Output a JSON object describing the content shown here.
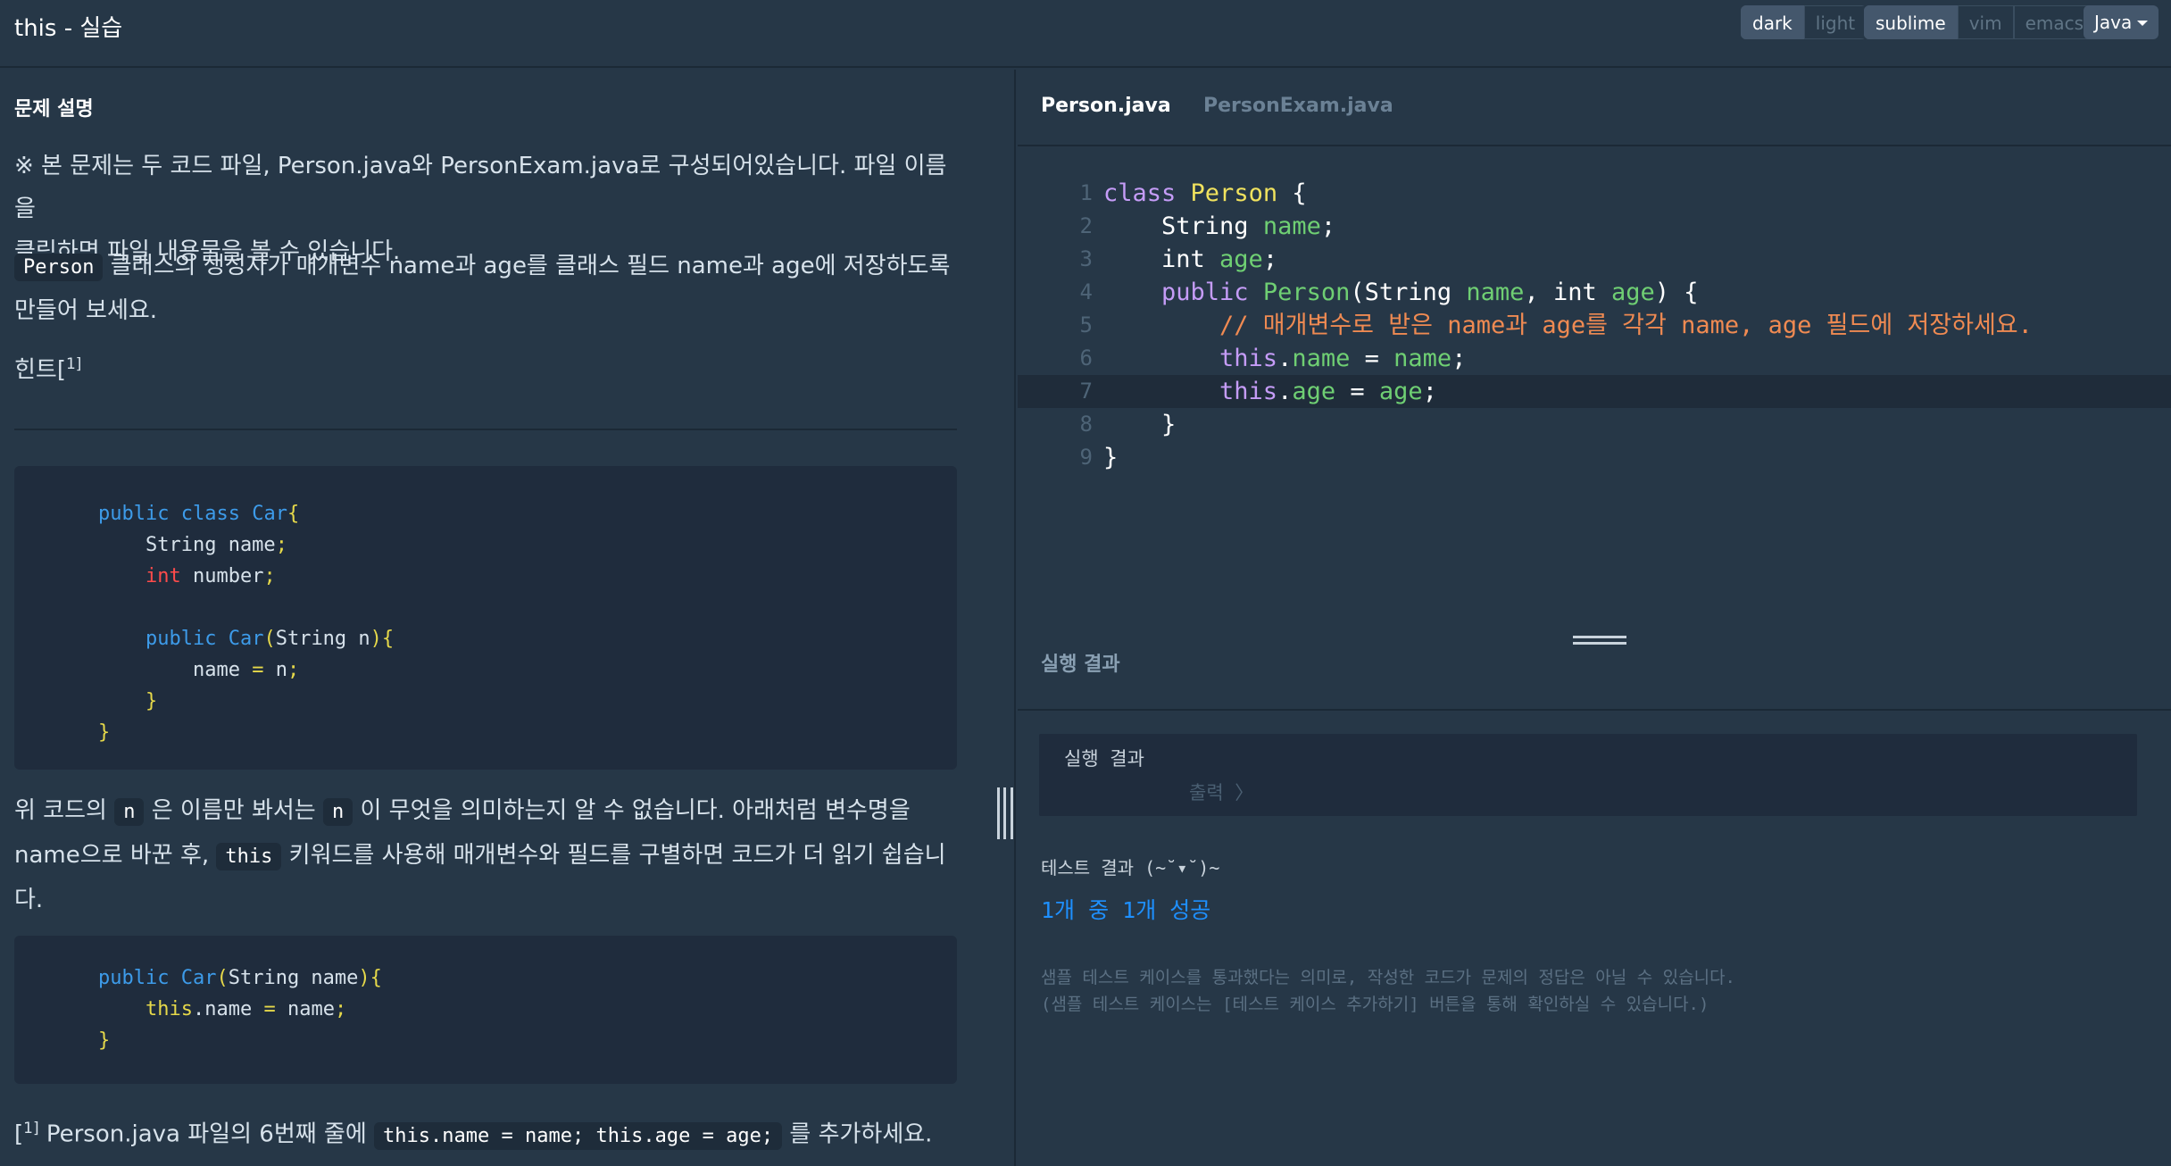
{
  "header": {
    "title": "this - 실습",
    "theme_options": [
      "dark",
      "light"
    ],
    "theme_selected": "dark",
    "keymap_options": [
      "sublime",
      "vim",
      "emacs"
    ],
    "keymap_selected": "sublime",
    "language": "Java"
  },
  "problem": {
    "section_title": "문제 설명",
    "intro_line1": "※ 본 문제는 두 코드 파일, Person.java와 PersonExam.java로 구성되어있습니다. 파일 이름을",
    "intro_line2": "클릭하면 파일 내용물을 볼 수 있습니다.",
    "task_code": "Person",
    "task_line1": " 클래스의 생성자가 매개변수 name과 age를 클래스 필드 name과 age에 저장하도록",
    "task_line2": "만들어 보세요.",
    "hint_label": "힌트[",
    "hint_sup": "1]",
    "code_block_1": [
      [
        [
          "public ",
          "blue"
        ],
        [
          "class ",
          "blue"
        ],
        [
          "Car",
          "blue"
        ],
        [
          "{",
          "yellow"
        ]
      ],
      [
        [
          "    String name",
          "plain"
        ],
        [
          ";",
          "yellow"
        ]
      ],
      [
        [
          "    int",
          "red"
        ],
        [
          " number",
          "plain"
        ],
        [
          ";",
          "yellow"
        ]
      ],
      [
        [
          "",
          "plain"
        ]
      ],
      [
        [
          "    public ",
          "blue"
        ],
        [
          "Car",
          "blue"
        ],
        [
          "(",
          "yellow"
        ],
        [
          "String n",
          "plain"
        ],
        [
          ")",
          "yellow"
        ],
        [
          "{",
          "yellow"
        ]
      ],
      [
        [
          "        name ",
          "plain"
        ],
        [
          "= ",
          "yellow"
        ],
        [
          "n",
          "plain"
        ],
        [
          ";",
          "yellow"
        ]
      ],
      [
        [
          "    }",
          "yellow"
        ]
      ],
      [
        [
          "}",
          "yellow"
        ]
      ]
    ],
    "explain_line1_a": "위 코드의 ",
    "explain_code_n1": "n",
    "explain_line1_b": " 은 이름만 봐서는 ",
    "explain_code_n2": "n",
    "explain_line1_c": " 이 무엇을 의미하는지 알 수 없습니다. 아래처럼 변수명을",
    "explain_line2_a": "name으로 바꾼 후, ",
    "explain_code_this": "this",
    "explain_line2_b": " 키워드를 사용해 매개변수와 필드를 구별하면 코드가 더 읽기 쉽습니",
    "explain_line3": "다.",
    "code_block_2": [
      [
        [
          "public ",
          "blue"
        ],
        [
          "Car",
          "blue"
        ],
        [
          "(",
          "yellow"
        ],
        [
          "String name",
          "plain"
        ],
        [
          ")",
          "yellow"
        ],
        [
          "{",
          "yellow"
        ]
      ],
      [
        [
          "    this",
          "yellow"
        ],
        [
          ".name ",
          "plain"
        ],
        [
          "= ",
          "yellow"
        ],
        [
          "name",
          "plain"
        ],
        [
          ";",
          "yellow"
        ]
      ],
      [
        [
          "}",
          "yellow"
        ]
      ]
    ],
    "footnote_mark": "[",
    "footnote_sup": "1]",
    "footnote_text_a": " Person.java 파일의 6번째 줄에 ",
    "footnote_code": "this.name = name; this.age = age;",
    "footnote_text_b": " 를 추가하세요."
  },
  "editor": {
    "tabs": [
      "Person.java",
      "PersonExam.java"
    ],
    "active_tab": "Person.java",
    "current_line": 7,
    "lines": [
      [
        [
          "class ",
          "kw"
        ],
        [
          "Person",
          "cls"
        ],
        [
          " {",
          "plain"
        ]
      ],
      [
        [
          "    String ",
          "plain"
        ],
        [
          "name",
          "var"
        ],
        [
          ";",
          "plain"
        ]
      ],
      [
        [
          "    int ",
          "plain"
        ],
        [
          "age",
          "var"
        ],
        [
          ";",
          "plain"
        ]
      ],
      [
        [
          "    public ",
          "kw"
        ],
        [
          "Person",
          "fn"
        ],
        [
          "(String ",
          "plain"
        ],
        [
          "name",
          "var"
        ],
        [
          ", int ",
          "plain"
        ],
        [
          "age",
          "var"
        ],
        [
          ") {",
          "plain"
        ]
      ],
      [
        [
          "        // 매개변수로 받은 name과 age를 각각 name, age 필드에 저장하세요.",
          "com"
        ]
      ],
      [
        [
          "        this",
          "kw"
        ],
        [
          ".",
          "plain"
        ],
        [
          "name",
          "var"
        ],
        [
          " = ",
          "plain"
        ],
        [
          "name",
          "var"
        ],
        [
          ";",
          "plain"
        ]
      ],
      [
        [
          "        this",
          "kw"
        ],
        [
          ".",
          "plain"
        ],
        [
          "age",
          "var"
        ],
        [
          " = ",
          "plain"
        ],
        [
          "age",
          "var"
        ],
        [
          ";",
          "plain"
        ]
      ],
      [
        [
          "    }",
          "plain"
        ]
      ],
      [
        [
          "}",
          "plain"
        ]
      ]
    ]
  },
  "result": {
    "header_label": "실행 결과",
    "box_title": "실행 결과",
    "output_placeholder": "출력 〉",
    "test_label": "테스트 결과 (~˘▾˘)~",
    "test_summary": "1개 중 1개 성공",
    "note_line1": "샘플 테스트 케이스를 통과했다는 의미로, 작성한 코드가 문제의 정답은 아닐 수 있습니다.",
    "note_line2": "(샘플 테스트 케이스는 [테스트 케이스 추가하기] 버튼을 통해 확인하실 수 있습니다.)"
  },
  "colors": {
    "background": "#263747",
    "code_bg": "#1f2c3d",
    "accent_blue": "#3d9be9",
    "success_blue": "#1e90ff"
  }
}
